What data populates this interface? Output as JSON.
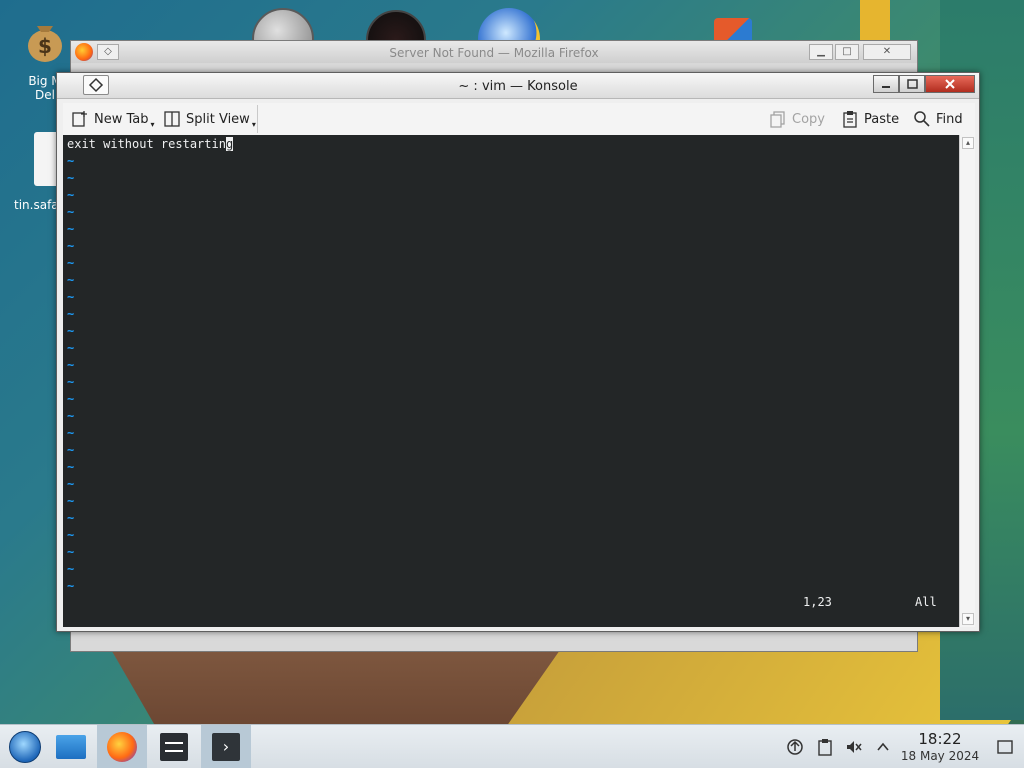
{
  "desktop": {
    "icons": [
      {
        "label": "Big M\nDel"
      },
      {
        "label": "tin.safa"
      }
    ]
  },
  "background_window": {
    "title": "Server Not Found — Mozilla Firefox"
  },
  "konsole": {
    "title": "~ : vim — Konsole",
    "toolbar": {
      "new_tab": "New Tab",
      "split_view": "Split View",
      "copy": "Copy",
      "paste": "Paste",
      "find": "Find"
    },
    "terminal": {
      "first_line_text": "exit without restartin",
      "cursor_char": "g",
      "tilde": "~",
      "tilde_count": 26,
      "position": "1,23",
      "scroll_status": "All"
    }
  },
  "taskbar": {
    "clock_time": "18:22",
    "clock_date": "18 May 2024"
  },
  "colors": {
    "terminal_bg": "#232627",
    "terminal_fg": "#eff0f1",
    "tilde": "#1d99f3",
    "close_button": "#c0392b"
  }
}
